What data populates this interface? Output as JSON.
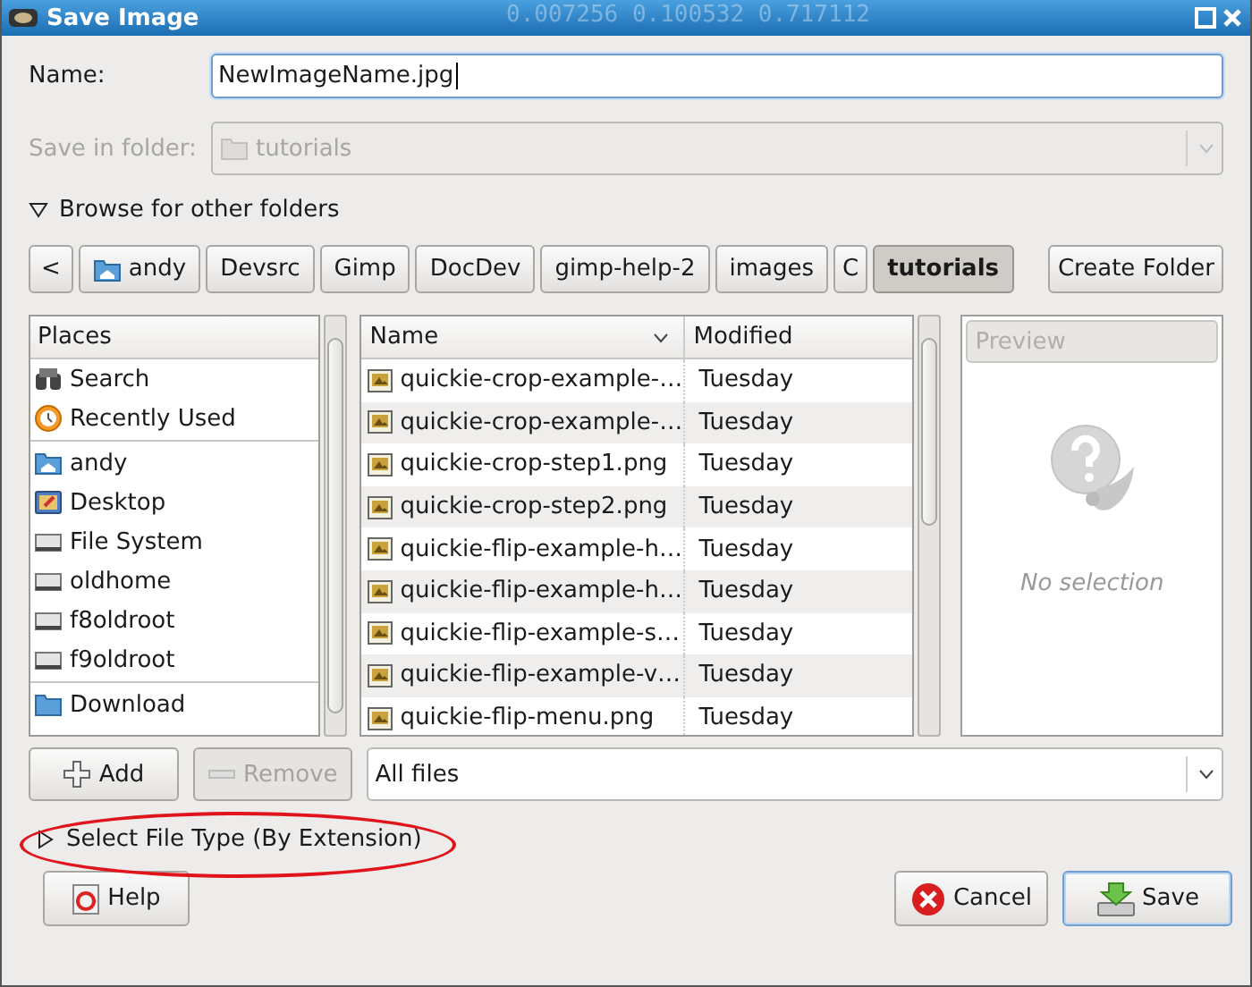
{
  "window": {
    "title": "Save Image",
    "background_text": "0.007256 0.100532 0.717112"
  },
  "name_field": {
    "label": "Name:",
    "value": "NewImageName.jpg"
  },
  "folder_combo": {
    "label": "Save in folder:",
    "value": "tutorials",
    "disabled": true
  },
  "browse_expander": {
    "label": "Browse for other folders",
    "expanded": true
  },
  "path_bar": {
    "back": "<",
    "items": [
      {
        "label": "andy",
        "selected": false,
        "kind": "home"
      },
      {
        "label": "Devsrc",
        "selected": false,
        "kind": "plain"
      },
      {
        "label": "Gimp",
        "selected": false,
        "kind": "plain"
      },
      {
        "label": "DocDev",
        "selected": false,
        "kind": "plain"
      },
      {
        "label": "gimp-help-2",
        "selected": false,
        "kind": "plain"
      },
      {
        "label": "images",
        "selected": false,
        "kind": "plain"
      },
      {
        "label": "C",
        "selected": false,
        "kind": "plain"
      },
      {
        "label": "tutorials",
        "selected": true,
        "kind": "plain"
      }
    ]
  },
  "create_folder": "Create Folder",
  "places": {
    "heading": "Places",
    "groups": [
      [
        {
          "label": "Search",
          "kind": "search"
        },
        {
          "label": "Recently Used",
          "kind": "recent"
        }
      ],
      [
        {
          "label": "andy",
          "kind": "home"
        },
        {
          "label": "Desktop",
          "kind": "desktop"
        },
        {
          "label": "File System",
          "kind": "drive"
        },
        {
          "label": "oldhome",
          "kind": "drive"
        },
        {
          "label": "f8oldroot",
          "kind": "drive"
        },
        {
          "label": "f9oldroot",
          "kind": "drive"
        }
      ],
      [
        {
          "label": "Download",
          "kind": "folder"
        }
      ]
    ]
  },
  "files": {
    "columns": [
      "Name",
      "Modified"
    ],
    "rows": [
      {
        "name": "quickie-crop-example-…",
        "modified": "Tuesday"
      },
      {
        "name": "quickie-crop-example-…",
        "modified": "Tuesday"
      },
      {
        "name": "quickie-crop-step1.png",
        "modified": "Tuesday"
      },
      {
        "name": "quickie-crop-step2.png",
        "modified": "Tuesday"
      },
      {
        "name": "quickie-flip-example-h…",
        "modified": "Tuesday"
      },
      {
        "name": "quickie-flip-example-h…",
        "modified": "Tuesday"
      },
      {
        "name": "quickie-flip-example-s…",
        "modified": "Tuesday"
      },
      {
        "name": "quickie-flip-example-v…",
        "modified": "Tuesday"
      },
      {
        "name": "quickie-flip-menu.png",
        "modified": "Tuesday"
      }
    ]
  },
  "preview": {
    "heading": "Preview",
    "text": "No selection"
  },
  "add_button": {
    "label": "Add",
    "disabled": false
  },
  "remove_button": {
    "label": "Remove",
    "disabled": true
  },
  "filter_combo": {
    "value": "All files"
  },
  "file_type_expander": {
    "label": "Select File Type (By Extension)",
    "expanded": false,
    "highlighted": true
  },
  "buttons": [
    {
      "label": "Help",
      "kind": "help"
    },
    {
      "label": "Cancel",
      "kind": "cancel"
    },
    {
      "label": "Save",
      "kind": "save"
    }
  ]
}
